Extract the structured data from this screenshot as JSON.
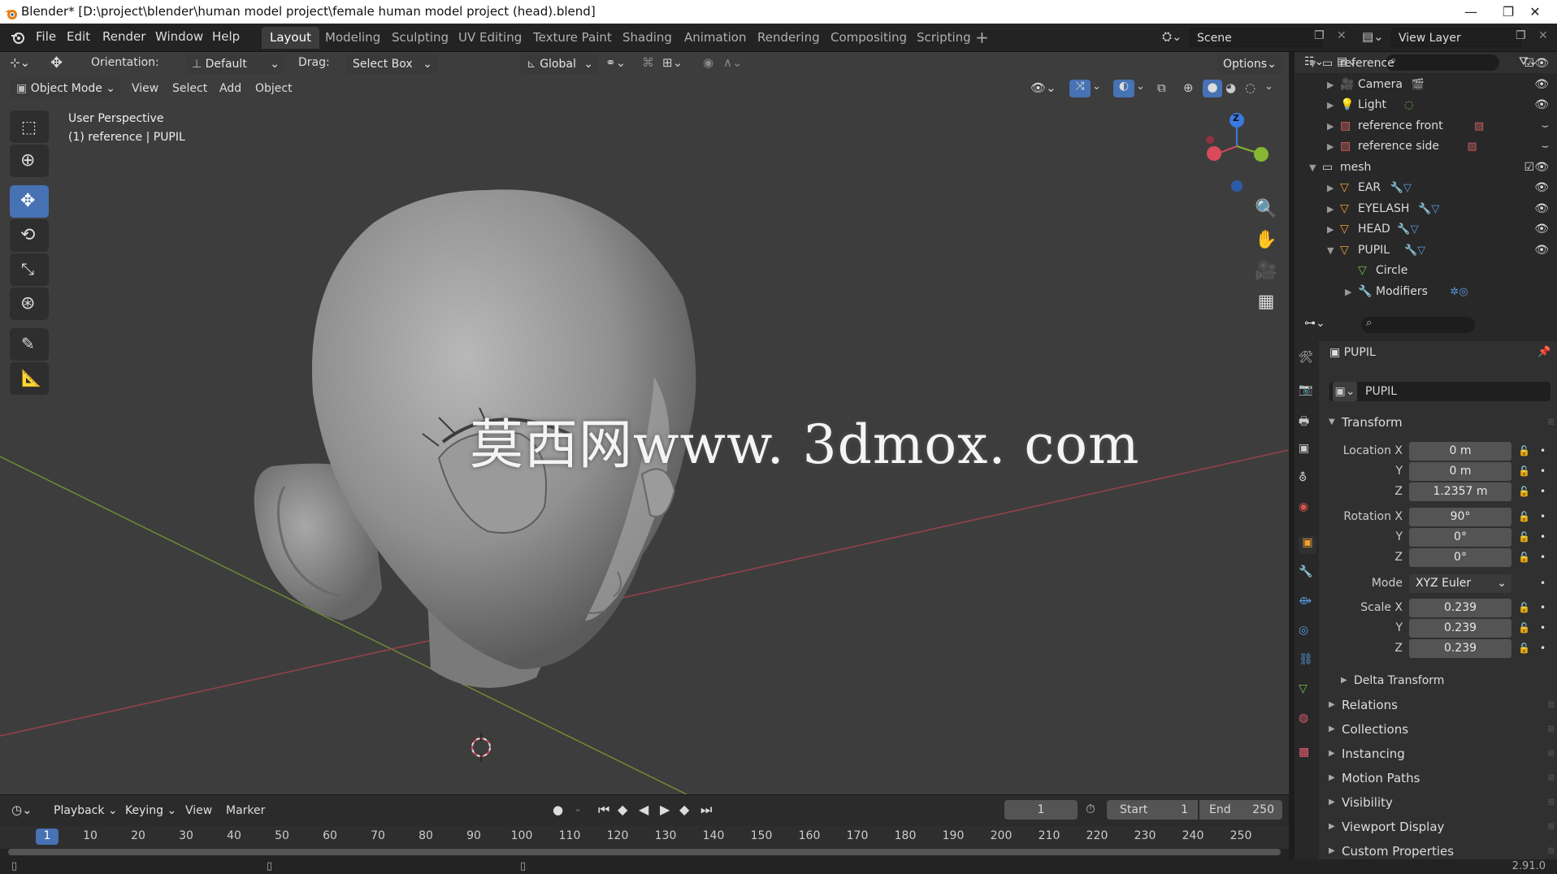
{
  "window": {
    "title": "Blender* [D:\\project\\blender\\human model project\\female human model project (head).blend]"
  },
  "menu": [
    "File",
    "Edit",
    "Render",
    "Window",
    "Help"
  ],
  "workspaces": [
    "Layout",
    "Modeling",
    "Sculpting",
    "UV Editing",
    "Texture Paint",
    "Shading",
    "Animation",
    "Rendering",
    "Compositing",
    "Scripting"
  ],
  "scene": {
    "label": "Scene",
    "view_layer": "View Layer"
  },
  "toolheader": {
    "orientation_label": "Orientation:",
    "orientation_value": "Default",
    "drag_label": "Drag:",
    "drag_value": "Select Box",
    "transform_value": "Global",
    "options_label": "Options"
  },
  "viewport": {
    "mode": "Object Mode",
    "menus": [
      "View",
      "Select",
      "Add",
      "Object"
    ],
    "perspective": "User Perspective",
    "collection_info": "(1) reference | PUPIL",
    "watermark": "莫西网www. 3dmox. com"
  },
  "gizmo": {
    "z": "Z"
  },
  "outliner": {
    "rows": [
      {
        "label": "reference",
        "indent": 0,
        "expanded": true,
        "type": "collection"
      },
      {
        "label": "Camera",
        "indent": 1,
        "type": "camera"
      },
      {
        "label": "Light",
        "indent": 1,
        "type": "light"
      },
      {
        "label": "reference front",
        "indent": 1,
        "type": "image"
      },
      {
        "label": "reference side",
        "indent": 1,
        "type": "image"
      },
      {
        "label": "mesh",
        "indent": 0,
        "expanded": true,
        "type": "collection"
      },
      {
        "label": "EAR",
        "indent": 1,
        "type": "mesh"
      },
      {
        "label": "EYELASH",
        "indent": 1,
        "type": "mesh"
      },
      {
        "label": "HEAD",
        "indent": 1,
        "type": "mesh"
      },
      {
        "label": "PUPIL",
        "indent": 1,
        "expanded": true,
        "type": "mesh"
      },
      {
        "label": "Circle",
        "indent": 2,
        "type": "data"
      },
      {
        "label": "Modifiers",
        "indent": 2,
        "type": "modifier"
      }
    ]
  },
  "properties": {
    "object_name": "PUPIL",
    "data_name": "PUPIL",
    "transform_label": "Transform",
    "location": {
      "label": "Location X",
      "x": "0 m",
      "y": "0 m",
      "z": "1.2357 m"
    },
    "rotation": {
      "label": "Rotation X",
      "x": "90°",
      "y": "0°",
      "z": "0°"
    },
    "mode": {
      "label": "Mode",
      "value": "XYZ Euler"
    },
    "scale": {
      "label": "Scale X",
      "x": "0.239",
      "y": "0.239",
      "z": "0.239"
    },
    "axis_y": "Y",
    "axis_z": "Z",
    "panels": [
      "Delta Transform",
      "Relations",
      "Collections",
      "Instancing",
      "Motion Paths",
      "Visibility",
      "Viewport Display",
      "Custom Properties"
    ]
  },
  "timeline": {
    "menus": [
      "Playback",
      "Keying",
      "View",
      "Marker"
    ],
    "current_frame": "1",
    "start_label": "Start",
    "start": "1",
    "end_label": "End",
    "end": "250",
    "ticks": [
      "1",
      "10",
      "20",
      "30",
      "40",
      "50",
      "60",
      "70",
      "80",
      "90",
      "100",
      "110",
      "120",
      "130",
      "140",
      "150",
      "160",
      "170",
      "180",
      "190",
      "200",
      "210",
      "220",
      "230",
      "240",
      "250"
    ]
  },
  "status": {
    "version": "2.91.0"
  },
  "colors": {
    "accent": "#4772b3",
    "active_tab": "#3d3d3d",
    "x_axis": "#d94a5c",
    "y_axis": "#86b632",
    "z_axis": "#3a7ae0"
  }
}
